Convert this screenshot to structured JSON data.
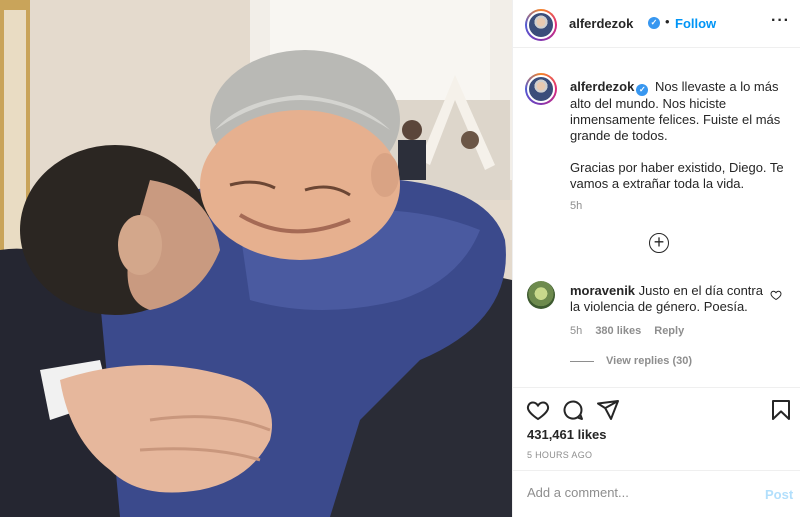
{
  "header": {
    "username": "alferdezok",
    "verified_mark": "✓",
    "separator": "•",
    "follow_label": "Follow",
    "more_label": "···"
  },
  "caption": {
    "username": "alferdezok",
    "text": "Nos llevaste a lo más alto del mundo. Nos hiciste inmensamente felices. Fuiste el más grande de todos.\n\nGracias por haber existido, Diego. Te vamos a extrañar toda la vida.",
    "time": "5h"
  },
  "load_more": {
    "icon": "plus-circle-icon",
    "label": "+"
  },
  "comment": {
    "username": "moravenik",
    "text": "Justo en el día contra la violencia de género. Poesía.",
    "time": "5h",
    "likes": "380 likes",
    "reply_label": "Reply",
    "view_replies": "View replies (30)"
  },
  "actions": {
    "icons": [
      "heart-icon",
      "comment-icon",
      "share-icon",
      "bookmark-icon"
    ],
    "likes": "431,461 likes",
    "time_ago": "5 HOURS AGO"
  },
  "add_comment": {
    "placeholder": "Add a comment...",
    "post_label": "Post"
  },
  "colors": {
    "link_blue": "#0095f6",
    "verified_blue": "#3897f0",
    "muted": "#8e8e8e",
    "post_disabled": "#b2dffc"
  }
}
